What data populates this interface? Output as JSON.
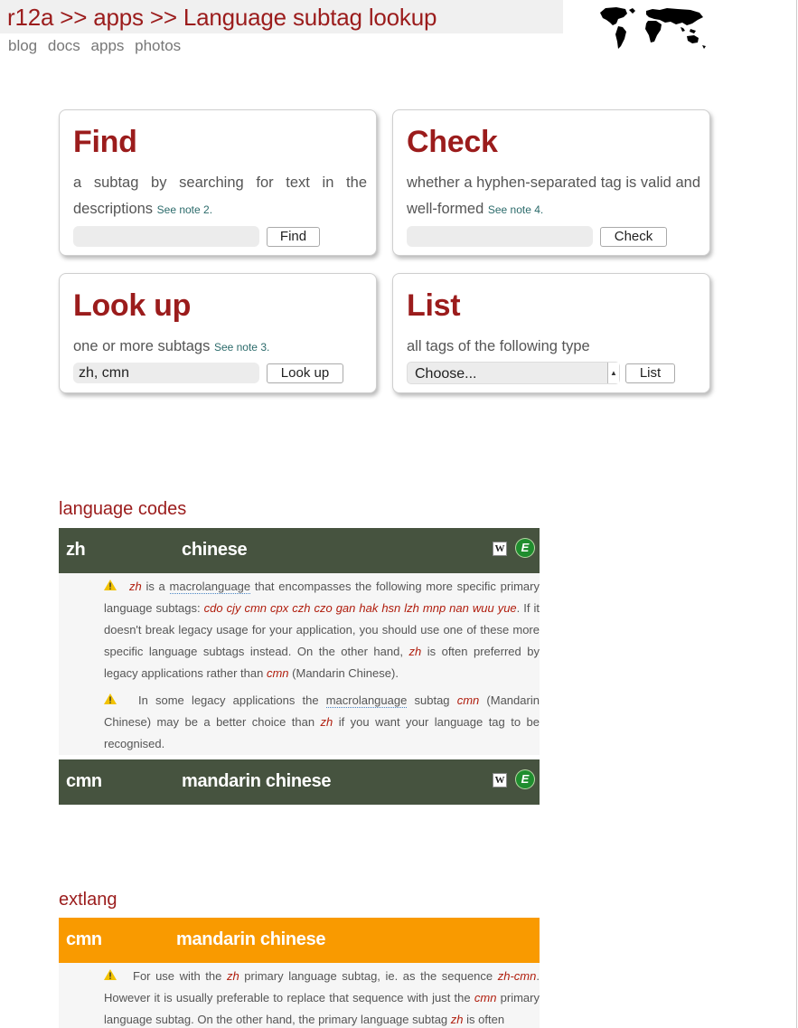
{
  "header": {
    "title": "r12a >> apps >> Language subtag lookup",
    "nav": [
      "blog",
      "docs",
      "apps",
      "photos"
    ]
  },
  "cards": {
    "find": {
      "heading": "Find",
      "desc": "a subtag by searching for text in the descriptions",
      "note": "See note 2.",
      "input_value": "",
      "button": "Find"
    },
    "check": {
      "heading": "Check",
      "desc": "whether a hyphen-separated tag is valid and well-formed",
      "note": "See note 4.",
      "input_value": "",
      "button": "Check"
    },
    "lookup": {
      "heading": "Look up",
      "desc": "one or more subtags",
      "note": "See note 3.",
      "input_value": "zh, cmn",
      "button": "Look up"
    },
    "list": {
      "heading": "List",
      "desc": "all tags of the following type",
      "select_value": "Choose...",
      "button": "List"
    }
  },
  "results": {
    "language_codes": {
      "title": "language codes",
      "entries": [
        {
          "code": "zh",
          "name": "chinese"
        },
        {
          "code": "cmn",
          "name": "mandarin chinese"
        }
      ],
      "zh_note1": {
        "t1": "is a",
        "macrolanguage": "macrolanguage",
        "t2": "that encompasses the following more specific primary language subtags:",
        "subtags": "cdo cjy cmn cpx czh czo gan hak hsn lzh mnp nan wuu yue",
        "t3": ". If it doesn't break legacy usage for your application, you should use one of these more specific language subtags instead. On the other hand,",
        "t4": "is often preferred by legacy applications rather than",
        "t5": "(Mandarin Chinese)."
      },
      "zh_note2": {
        "t1": "In some legacy applications the",
        "macrolanguage": "macrolanguage",
        "t2": "subtag",
        "t3": "(Mandarin Chinese) may be a better choice than",
        "t4": "if you want your language tag to be recognised."
      }
    },
    "extlang": {
      "title": "extlang",
      "entry": {
        "code": "cmn",
        "name": "mandarin chinese"
      },
      "note": {
        "t1": "For use with the",
        "t2": "primary language subtag, ie. as the sequence",
        "seq": "zh-cmn",
        "t3": ". However it is usually preferable to replace that sequence with just the",
        "t4": "primary language subtag. On the other hand, the primary language subtag",
        "t5": "is often"
      }
    },
    "code_zh": "zh",
    "code_cmn": "cmn"
  },
  "icons": {
    "wikipedia": "W",
    "ethnologue": "E"
  },
  "colors": {
    "brand_red": "#9b1c1c",
    "bar_green": "#46533f",
    "bar_orange": "#f99a00"
  }
}
